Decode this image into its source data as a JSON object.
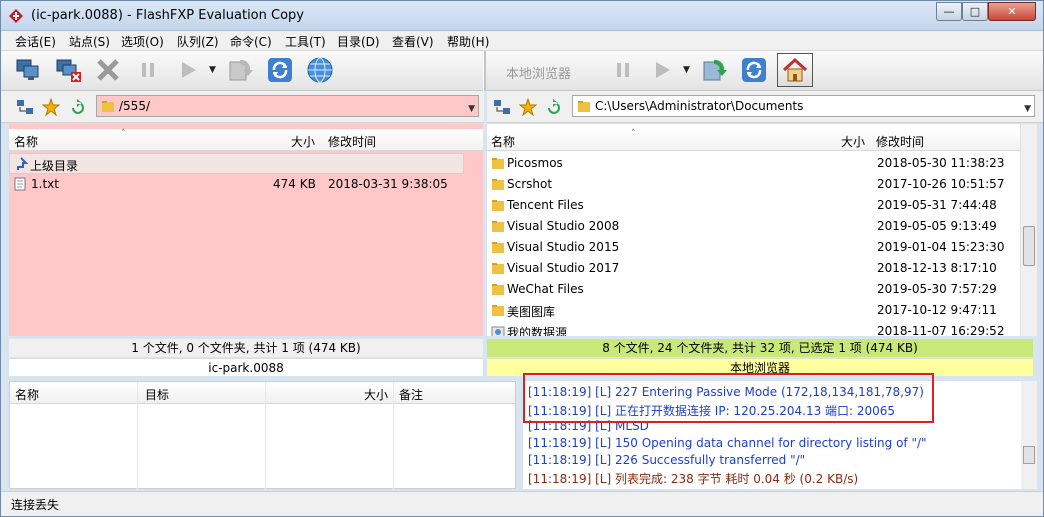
{
  "window": {
    "title": "(ic-park.0088) - FlashFXP Evaluation Copy",
    "controls": [
      "minimize-icon",
      "maximize-icon",
      "close-icon"
    ]
  },
  "menu": [
    "会话(E)",
    "站点(S)",
    "选项(O)",
    "队列(Z)",
    "命令(C)",
    "工具(T)",
    "目录(D)",
    "查看(V)",
    "帮助(H)"
  ],
  "toolbar": {
    "local_browser_label": "本地浏览器"
  },
  "left": {
    "path": "/555/",
    "columns": {
      "name": "名称",
      "size": "大小",
      "modified": "修改时间"
    },
    "parent_dir": "上级目录",
    "files": [
      {
        "name": "1.txt",
        "size": "474 KB",
        "modified": "2018-03-31 9:38:05"
      }
    ],
    "status": "1 个文件, 0 个文件夹, 共计 1 项 (474 KB)",
    "host": "ic-park.0088"
  },
  "right": {
    "path": "C:\\Users\\Administrator\\Documents",
    "columns": {
      "name": "名称",
      "size": "大小",
      "modified": "修改时间"
    },
    "files": [
      {
        "name": "Picosmos",
        "modified": "2018-05-30 11:38:23"
      },
      {
        "name": "Scrshot",
        "modified": "2017-10-26 10:51:57"
      },
      {
        "name": "Tencent Files",
        "modified": "2019-05-31 7:44:48"
      },
      {
        "name": "Visual Studio 2008",
        "modified": "2019-05-05 9:13:49"
      },
      {
        "name": "Visual Studio 2015",
        "modified": "2019-01-04 15:23:30"
      },
      {
        "name": "Visual Studio 2017",
        "modified": "2018-12-13 8:17:10"
      },
      {
        "name": "WeChat Files",
        "modified": "2019-05-30 7:57:29"
      },
      {
        "name": "美图图库",
        "modified": "2017-10-12 9:47:11"
      },
      {
        "name": "我的数据源",
        "modified": "2018-11-07 16:29:52"
      }
    ],
    "status": "8 个文件, 24 个文件夹, 共计 32 项, 已选定 1 项 (474 KB)",
    "host": "本地浏览器"
  },
  "queue": {
    "columns": {
      "name": "名称",
      "target": "目标",
      "size": "大小",
      "note": "备注"
    }
  },
  "log": [
    {
      "time": "[11:18:19]",
      "tag": "[L]",
      "msg": "227 Entering Passive Mode (172,18,134,181,78,97)",
      "color": "#1b3fd0"
    },
    {
      "time": "[11:18:19]",
      "tag": "[L]",
      "msg": "正在打开数据连接 IP: 120.25.204.13 端口: 20065",
      "color": "#1b3fd0"
    },
    {
      "time": "[11:18:19]",
      "tag": "[L]",
      "msg": "MLSD",
      "color": "#1b3fd0"
    },
    {
      "time": "[11:18:19]",
      "tag": "[L]",
      "msg": "150 Opening data channel for directory listing of \"/\"",
      "color": "#1b3fd0"
    },
    {
      "time": "[11:18:19]",
      "tag": "[L]",
      "msg": "226 Successfully transferred \"/\"",
      "color": "#1b3fd0"
    },
    {
      "time": "[11:18:19]",
      "tag": "[L]",
      "msg": "列表完成: 238 字节 耗时 0.04 秒 (0.2 KB/s)",
      "color": "#8b2a10"
    }
  ],
  "statusbar": {
    "text": "连接丢失"
  }
}
